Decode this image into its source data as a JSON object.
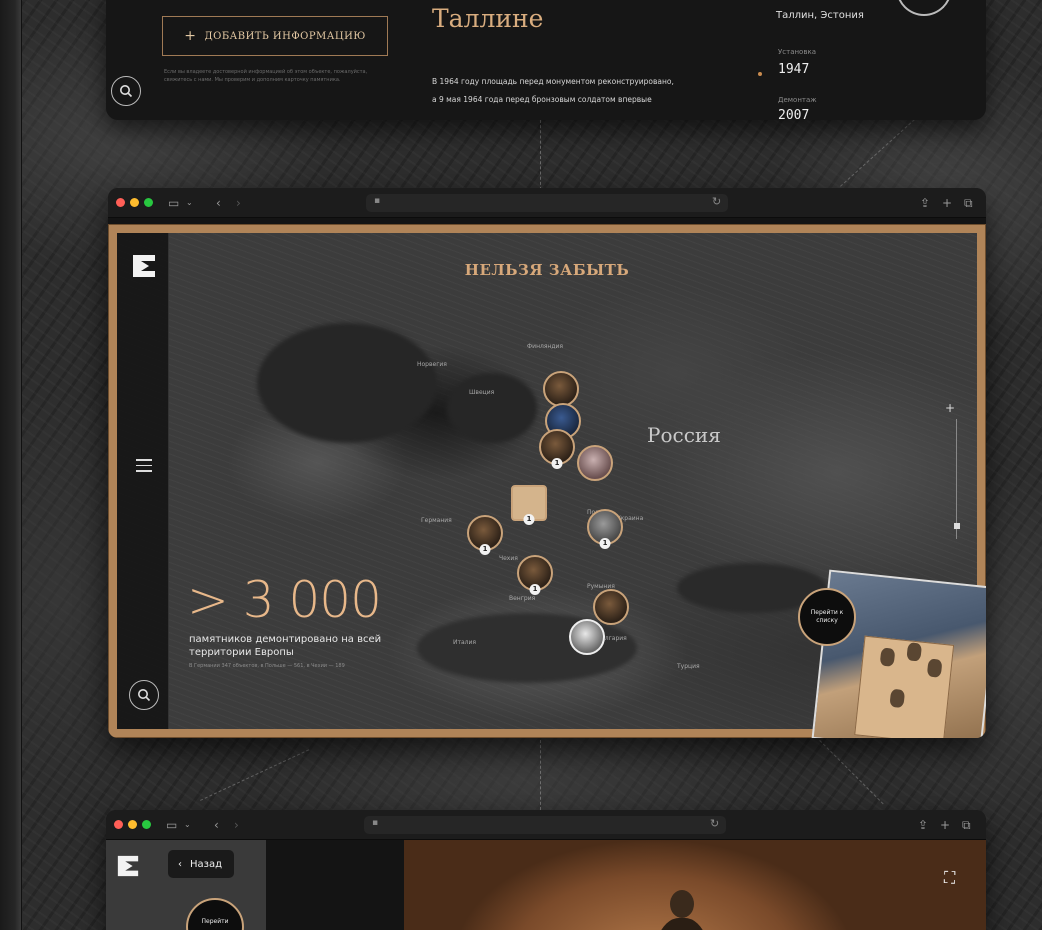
{
  "top_card": {
    "add_button_label": "ДОБАВИТЬ ИНФОРМАЦИЮ",
    "add_button_icon": "plus-icon",
    "fineprint": "Если вы владеете достоверной информацией об этом объекте, пожалуйста, свяжитесь с нами. Мы проверим и дополним карточку памятника.",
    "city_title": "Таллине",
    "paragraph_1": "В 1964 году площадь перед монументом реконструировано,",
    "paragraph_2": "а 9 мая 1964 года перед бронзовым солдатом впервые",
    "location": "Таллин, Эстония",
    "installed_label": "Установка",
    "installed_year": "1947",
    "dismantled_label": "Демонтаж",
    "dismantled_year": "2007",
    "search_icon": "search-icon"
  },
  "map_window": {
    "title": "НЕЛЬЗЯ ЗАБЫТЬ",
    "country_label": "Россия",
    "stat_value": "> 3 000",
    "stat_text": "памятников демонтировано на всей территории Европы",
    "stat_small": "В Германии 347 объектов, в Польше — 561, в Чехии — 189",
    "goto_list_label": "Перейти к списку",
    "zoom_in": "+",
    "places": [
      "Финляндия",
      "Норвегия",
      "Швеция",
      "Германия",
      "Польша",
      "Украина",
      "Чехия",
      "Венгрия",
      "Румыния",
      "Италия",
      "Болгария",
      "Турция"
    ],
    "pin_badge": "1",
    "search_icon": "search-icon",
    "menu_icon": "menu-icon",
    "logo": "site-logo"
  },
  "bottom_window": {
    "back_label": "Назад",
    "goto_label": "Перейти",
    "fullscreen_icon": "fullscreen-icon"
  },
  "colors": {
    "accent": "#d9ad7f",
    "frame": "#b08458",
    "background": "#2d2d2d"
  }
}
